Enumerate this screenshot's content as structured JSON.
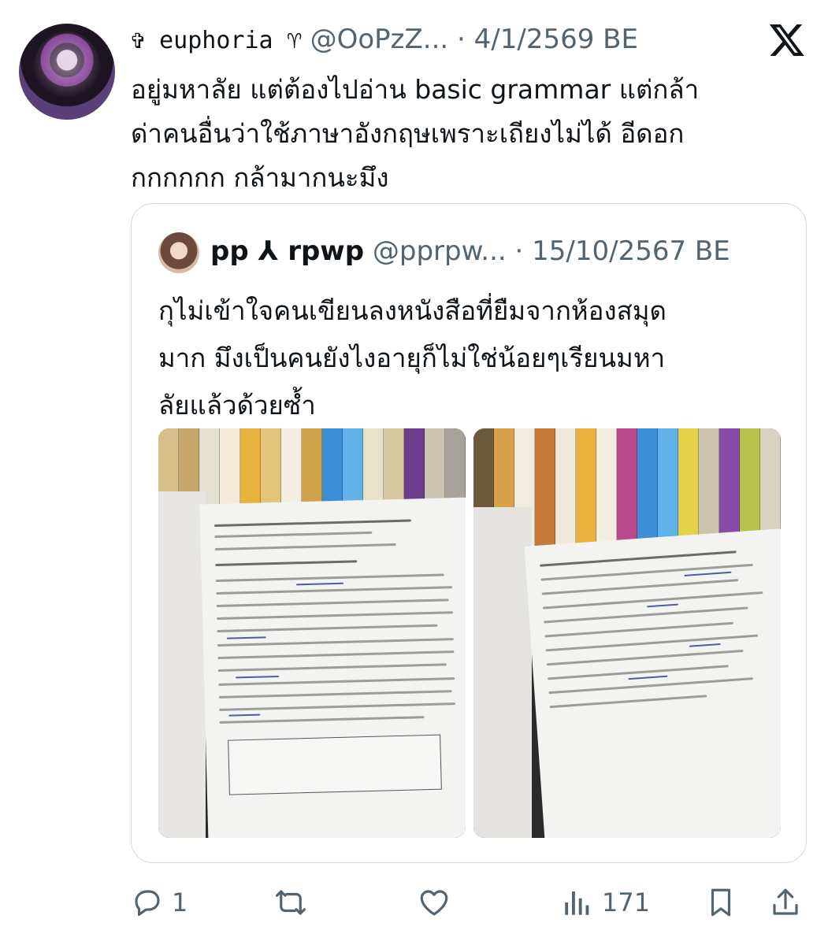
{
  "tweet": {
    "display_name": "✞ euphoria ♈",
    "handle": "@OoPzZ...",
    "separator": "·",
    "date": "4/1/2569 BE",
    "text_lines": [
      "อยู่มหาลัย แต่ต้องไปอ่าน basic grammar แต่กล้า",
      "ด่าคนอื่นว่าใช้ภาษาอังกฤษเพราะเถียงไม่ได้ อีดอก",
      "กกกกกก กล้ามากนะมึง"
    ]
  },
  "quoted_tweet": {
    "display_name": "pp ⅄ rpwp",
    "handle": "@pprpw...",
    "separator": "·",
    "date": "15/10/2567 BE",
    "text_lines": [
      "กุไม่เข้าใจคนเขียนลงหนังสือที่ยืมจากห้องสมุด",
      "มาก มึงเป็นคนยังไงอายุก็ไม่ใช่น้อยๆเรียนมหา",
      "ลัยแล้วด้วยซ้ำ"
    ]
  },
  "actions": {
    "replies": "1",
    "views": "171"
  },
  "icons": {
    "platform_logo": "x-logo-icon",
    "reply": "reply-icon",
    "repost": "repost-icon",
    "like": "heart-icon",
    "views": "views-icon",
    "bookmark": "bookmark-icon",
    "share": "share-icon"
  }
}
